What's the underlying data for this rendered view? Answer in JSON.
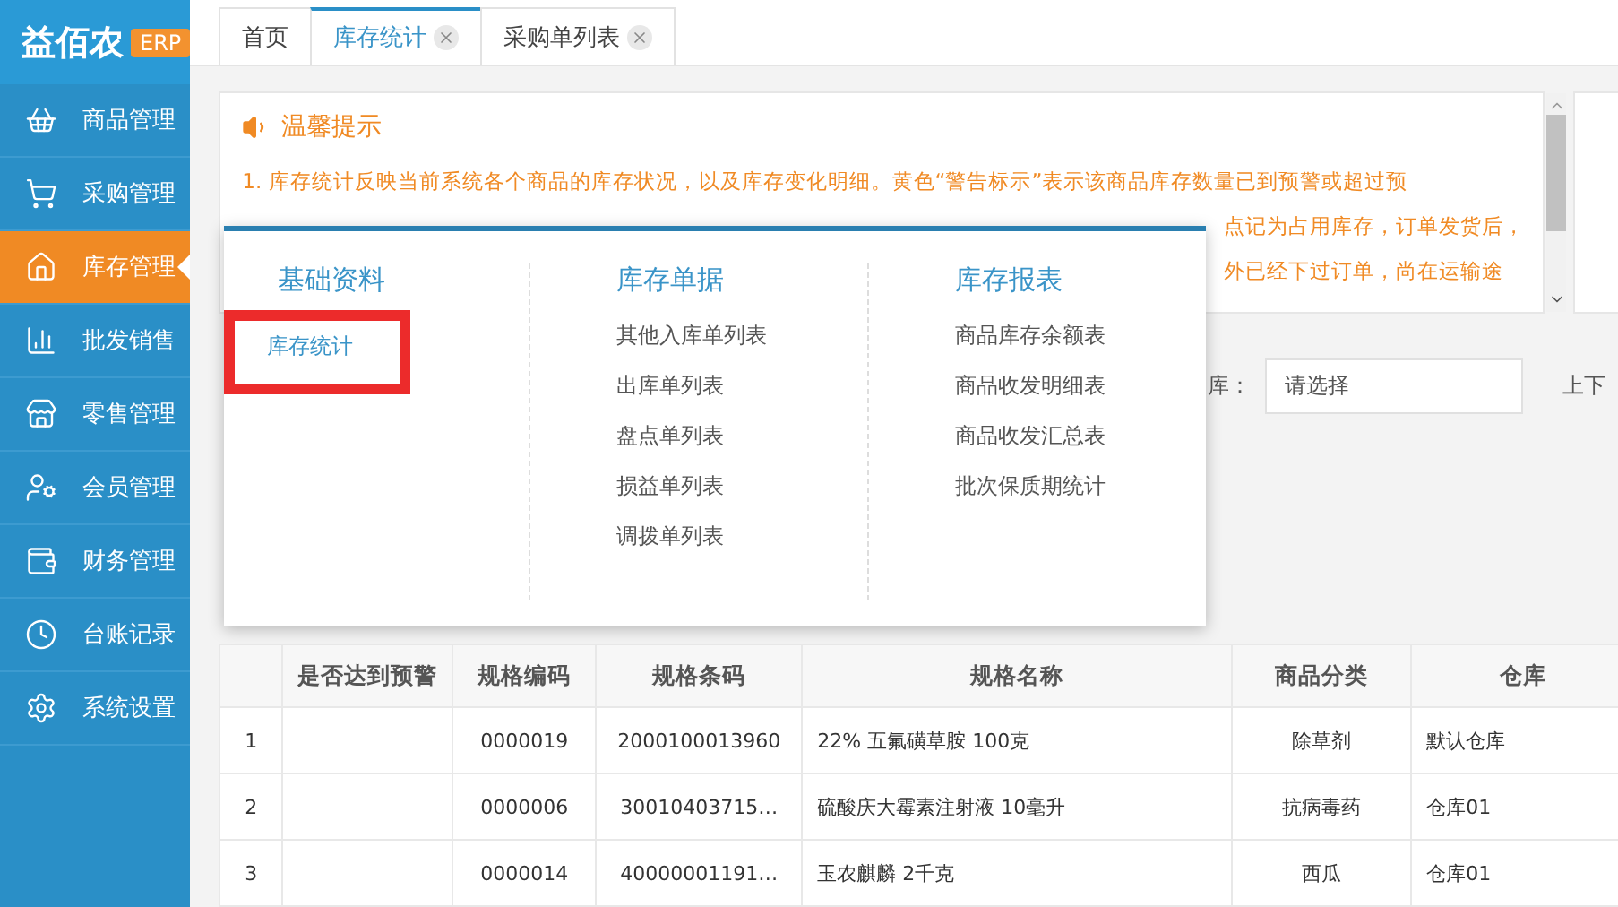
{
  "logo": {
    "name": "益佰农",
    "badge": "ERP"
  },
  "sidebar": {
    "items": [
      {
        "label": "商品管理",
        "selected": false
      },
      {
        "label": "采购管理",
        "selected": false
      },
      {
        "label": "库存管理",
        "selected": true
      },
      {
        "label": "批发销售",
        "selected": false
      },
      {
        "label": "零售管理",
        "selected": false
      },
      {
        "label": "会员管理",
        "selected": false
      },
      {
        "label": "财务管理",
        "selected": false
      },
      {
        "label": "台账记录",
        "selected": false
      },
      {
        "label": "系统设置",
        "selected": false
      }
    ]
  },
  "tabs": [
    {
      "label": "首页",
      "selected": false,
      "closable": false
    },
    {
      "label": "库存统计",
      "selected": true,
      "closable": true
    },
    {
      "label": "采购单列表",
      "selected": false,
      "closable": true
    }
  ],
  "notice": {
    "title": "温馨提示",
    "lines": [
      {
        "text": "1. 库存统计反映当前系统各个商品的库存状况，以及库存变化明细。黄色“警告标示”表示该商品库存数量已到预警或超过预",
        "partial": false
      },
      {
        "text": "点记为占用库存，订单发货后，",
        "partial": true
      },
      {
        "text": "外已经下过订单，尚在运输途",
        "partial": true
      }
    ]
  },
  "filter": {
    "label": "库：",
    "placeholder": "请选择",
    "next_label": "上下"
  },
  "menu": {
    "columns": [
      {
        "title": "基础资料",
        "items": [
          {
            "label": "库存统计",
            "selected": true
          }
        ]
      },
      {
        "title": "库存单据",
        "items": [
          {
            "label": "其他入库单列表",
            "selected": false
          },
          {
            "label": "出库单列表",
            "selected": false
          },
          {
            "label": "盘点单列表",
            "selected": false
          },
          {
            "label": "损益单列表",
            "selected": false
          },
          {
            "label": "调拨单列表",
            "selected": false
          }
        ]
      },
      {
        "title": "库存报表",
        "items": [
          {
            "label": "商品库存余额表",
            "selected": false
          },
          {
            "label": "商品收发明细表",
            "selected": false
          },
          {
            "label": "商品收发汇总表",
            "selected": false
          },
          {
            "label": "批次保质期统计",
            "selected": false
          }
        ]
      }
    ]
  },
  "table": {
    "columns": [
      "",
      "是否达到预警",
      "规格编码",
      "规格条码",
      "规格名称",
      "商品分类",
      "仓库"
    ],
    "rows": [
      [
        "1",
        "",
        "0000019",
        "2000100013960",
        "22% 五氟磺草胺 100克",
        "除草剂",
        "默认仓库"
      ],
      [
        "2",
        "",
        "0000006",
        "30010403715…",
        "硫酸庆大霉素注射液 10毫升",
        "抗病毒药",
        "仓库01"
      ],
      [
        "3",
        "",
        "0000014",
        "40000001191…",
        "玉农麒麟 2千克",
        "西瓜",
        "仓库01"
      ]
    ]
  }
}
